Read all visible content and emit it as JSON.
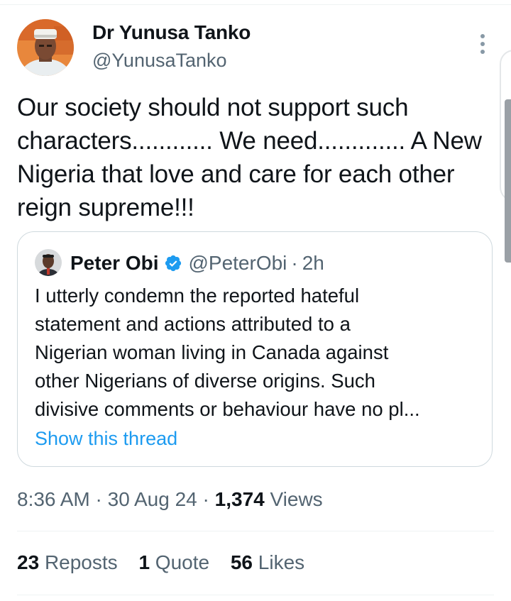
{
  "author": {
    "name": "Dr Yunusa Tanko",
    "handle": "@YunusaTanko"
  },
  "tweet": {
    "text": "Our society should not support such\ncharacters............ We need............. A New\nNigeria that love and care for each other\nreign supreme!!!"
  },
  "quote": {
    "name": "Peter Obi",
    "handle": "@PeterObi",
    "separator": "·",
    "time": "2h",
    "text": "I utterly condemn the reported hateful\nstatement and actions attributed to a\nNigerian woman living in Canada against\nother Nigerians of diverse origins. Such\ndivisive comments or behaviour have no pl...",
    "show_thread_label": "Show this thread"
  },
  "meta": {
    "time": "8:36 AM",
    "date": "30 Aug 24",
    "separator": "·",
    "views_count": "1,374",
    "views_label": "Views"
  },
  "stats": {
    "reposts_count": "23",
    "reposts_label": "Reposts",
    "quotes_count": "1",
    "quotes_label": "Quote",
    "likes_count": "56",
    "likes_label": "Likes"
  },
  "colors": {
    "accent": "#1d9bf0",
    "secondary_text": "#536471",
    "primary_text": "#0f1419",
    "border": "#cfd9de"
  },
  "icons": [
    "more-icon",
    "verified-badge-icon"
  ]
}
